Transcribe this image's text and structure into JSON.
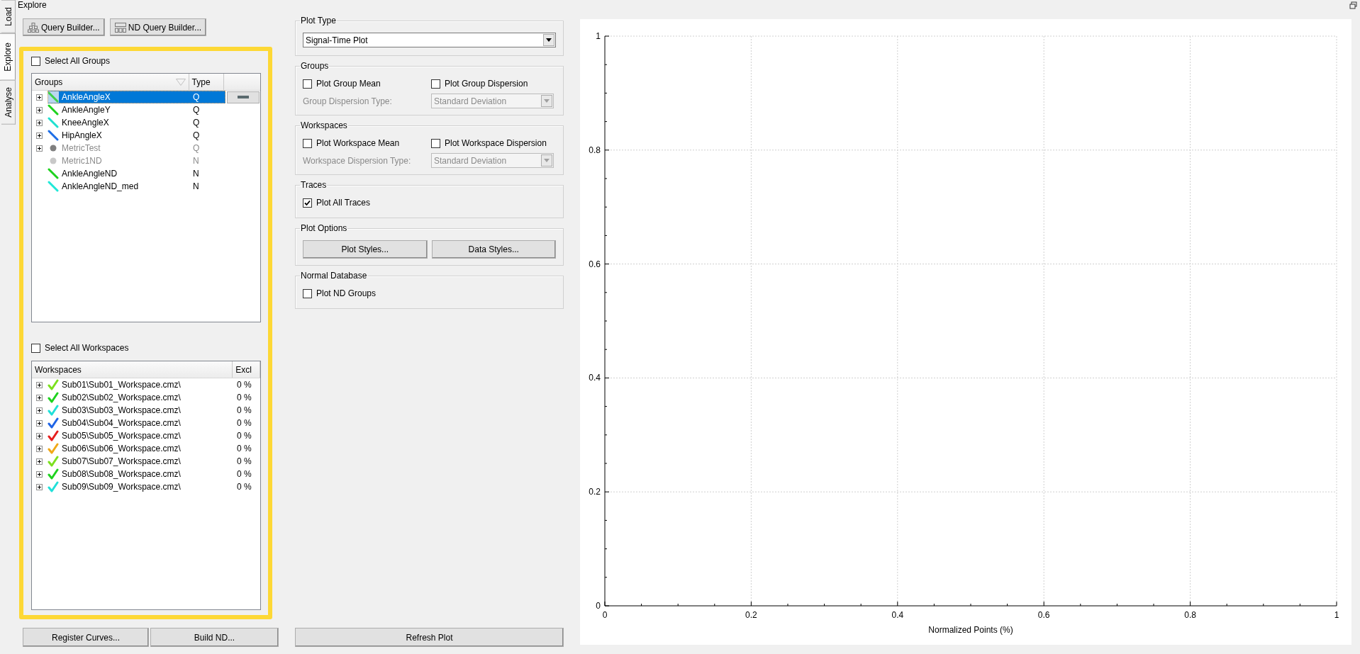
{
  "side_tabs": [
    {
      "label": "Load",
      "selected": false
    },
    {
      "label": "Explore",
      "selected": true
    },
    {
      "label": "Analyse",
      "selected": false
    }
  ],
  "panel_title": "Explore",
  "toolbar": [
    {
      "label": "Query Builder...",
      "kind": "hierarchy"
    },
    {
      "label": "ND Query Builder...",
      "kind": "grid"
    }
  ],
  "select_all_groups": {
    "label": "Select All Groups",
    "checked": false
  },
  "groups_table": {
    "columns": [
      "Groups",
      "Type"
    ],
    "rows": [
      {
        "name": "AnkleAngleX",
        "type": "Q",
        "kind": "line",
        "color": "#3fcf4a",
        "expandable": true,
        "disabled": false,
        "selected": true
      },
      {
        "name": "AnkleAngleY",
        "type": "Q",
        "kind": "line",
        "color": "#1ed21e",
        "expandable": true,
        "disabled": false,
        "selected": false
      },
      {
        "name": "KneeAngleX",
        "type": "Q",
        "kind": "line",
        "color": "#20e0d0",
        "expandable": true,
        "disabled": false,
        "selected": false
      },
      {
        "name": "HipAngleX",
        "type": "Q",
        "kind": "line",
        "color": "#1e6ee6",
        "expandable": true,
        "disabled": false,
        "selected": false
      },
      {
        "name": "MetricTest",
        "type": "Q",
        "kind": "dot",
        "color": "#7f7f7f",
        "expandable": true,
        "disabled": true,
        "selected": false
      },
      {
        "name": "Metric1ND",
        "type": "N",
        "kind": "dot",
        "color": "#c8c8c8",
        "expandable": false,
        "disabled": true,
        "selected": false
      },
      {
        "name": "AnkleAngleND",
        "type": "N",
        "kind": "line",
        "color": "#1ed21e",
        "expandable": false,
        "disabled": false,
        "selected": false
      },
      {
        "name": "AnkleAngleND_med",
        "type": "N",
        "kind": "line",
        "color": "#20e8d8",
        "expandable": false,
        "disabled": false,
        "selected": false
      }
    ]
  },
  "select_all_workspaces": {
    "label": "Select All Workspaces",
    "checked": false
  },
  "workspaces_table": {
    "columns": [
      "Workspaces",
      "Excl"
    ],
    "rows": [
      {
        "name": "Sub01\\Sub01_Workspace.cmz\\",
        "excl": "0 %",
        "color": "#7ce01e"
      },
      {
        "name": "Sub02\\Sub02_Workspace.cmz\\",
        "excl": "0 %",
        "color": "#1ed21e"
      },
      {
        "name": "Sub03\\Sub03_Workspace.cmz\\",
        "excl": "0 %",
        "color": "#20e0d8"
      },
      {
        "name": "Sub04\\Sub04_Workspace.cmz\\",
        "excl": "0 %",
        "color": "#1e64e6"
      },
      {
        "name": "Sub05\\Sub05_Workspace.cmz\\",
        "excl": "0 %",
        "color": "#e61e1e"
      },
      {
        "name": "Sub06\\Sub06_Workspace.cmz\\",
        "excl": "0 %",
        "color": "#f0a818"
      },
      {
        "name": "Sub07\\Sub07_Workspace.cmz\\",
        "excl": "0 %",
        "color": "#7ce01f"
      },
      {
        "name": "Sub08\\Sub08_Workspace.cmz\\",
        "excl": "0 %",
        "color": "#1ed21f"
      },
      {
        "name": "Sub09\\Sub09_Workspace.cmz\\",
        "excl": "0 %",
        "color": "#20e0d9"
      }
    ]
  },
  "bottom_buttons": [
    "Register Curves...",
    "Build ND..."
  ],
  "sections": [
    {
      "kind": "dropdown",
      "title": "Plot Type",
      "value": "Signal-Time Plot"
    },
    {
      "kind": "dispersion",
      "title": "Groups",
      "checks": [
        {
          "label": "Plot Group Mean",
          "checked": false
        },
        {
          "label": "Plot Group Dispersion",
          "checked": false
        }
      ],
      "field_label": "Group Dispersion Type:",
      "value": "Standard Deviation",
      "disabled": true
    },
    {
      "kind": "dispersion",
      "title": "Workspaces",
      "checks": [
        {
          "label": "Plot Workspace Mean",
          "checked": false
        },
        {
          "label": "Plot Workspace Dispersion",
          "checked": false
        }
      ],
      "field_label": "Workspace Dispersion Type:",
      "value": "Standard Deviation",
      "disabled": true
    },
    {
      "kind": "checks",
      "title": "Traces",
      "checks": [
        {
          "label": "Plot All Traces",
          "checked": true
        }
      ]
    },
    {
      "kind": "buttons",
      "title": "Plot Options",
      "buttons": [
        "Plot Styles...",
        "Data Styles..."
      ]
    },
    {
      "kind": "checks",
      "title": "Normal Database",
      "checks": [
        {
          "label": "Plot ND Groups",
          "checked": false
        }
      ]
    }
  ],
  "refresh_button": "Refresh Plot",
  "chart": {
    "chart_data": {
      "type": "line",
      "grid": true,
      "xlabel": "Normalized Points (%)",
      "xlim": [
        0,
        1
      ],
      "ylim": [
        0,
        1
      ],
      "xticks": [
        0,
        0.2,
        0.4,
        0.6,
        0.8,
        1
      ],
      "yticks": [
        0,
        0.2,
        0.4,
        0.6,
        0.8,
        1
      ]
    }
  }
}
